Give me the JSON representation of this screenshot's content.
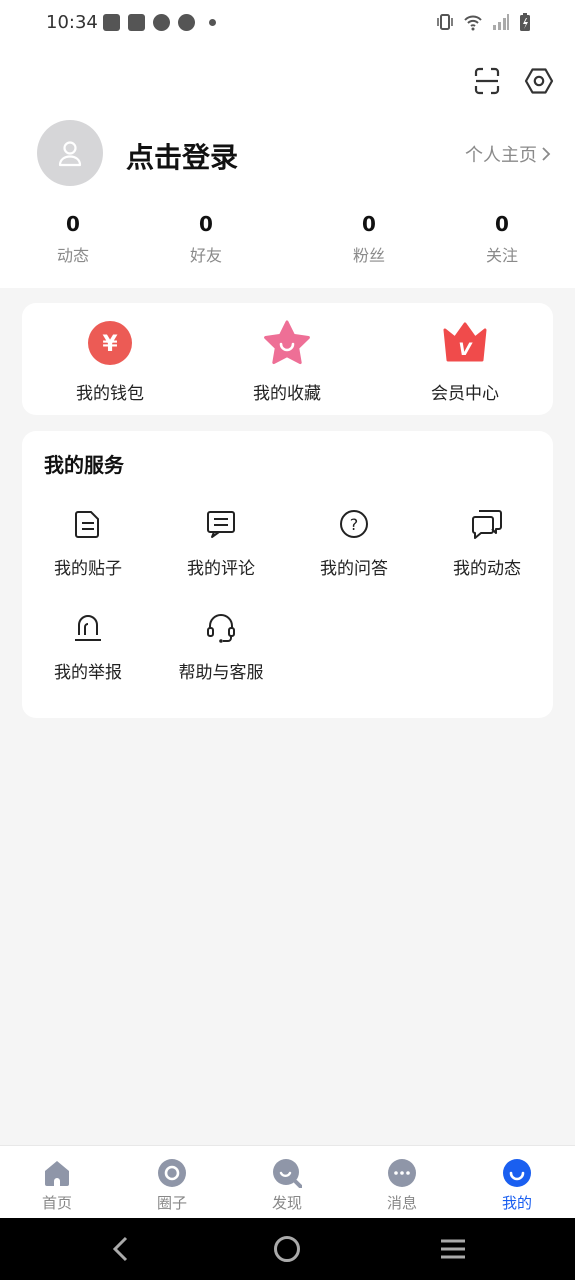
{
  "status": {
    "time": "10:34"
  },
  "header": {
    "login_text": "点击登录",
    "profile_link": "个人主页"
  },
  "stats": [
    {
      "value": "0",
      "label": "动态"
    },
    {
      "value": "0",
      "label": "好友"
    },
    {
      "value": "0",
      "label": "粉丝"
    },
    {
      "value": "0",
      "label": "关注"
    }
  ],
  "quick": [
    {
      "label": "我的钱包",
      "icon": "wallet-yen-icon",
      "glyph": "¥"
    },
    {
      "label": "我的收藏",
      "icon": "favorite-star-icon"
    },
    {
      "label": "会员中心",
      "icon": "vip-crown-icon",
      "glyph": "V"
    }
  ],
  "services": {
    "title": "我的服务",
    "items": [
      {
        "label": "我的贴子",
        "icon": "document-icon"
      },
      {
        "label": "我的评论",
        "icon": "comment-icon"
      },
      {
        "label": "我的问答",
        "icon": "question-icon",
        "glyph": "?"
      },
      {
        "label": "我的动态",
        "icon": "chat-bubbles-icon"
      },
      {
        "label": "我的举报",
        "icon": "report-icon"
      },
      {
        "label": "帮助与客服",
        "icon": "headset-icon"
      }
    ]
  },
  "nav": [
    {
      "label": "首页",
      "icon": "home-icon"
    },
    {
      "label": "圈子",
      "icon": "circle-icon"
    },
    {
      "label": "发现",
      "icon": "discover-icon"
    },
    {
      "label": "消息",
      "icon": "message-icon"
    },
    {
      "label": "我的",
      "icon": "profile-icon",
      "active": true
    }
  ],
  "colors": {
    "accent": "#1a5ff0",
    "wallet": "#ec5b55",
    "favorite": "#ee6f96",
    "vip": "#f04b4b"
  }
}
